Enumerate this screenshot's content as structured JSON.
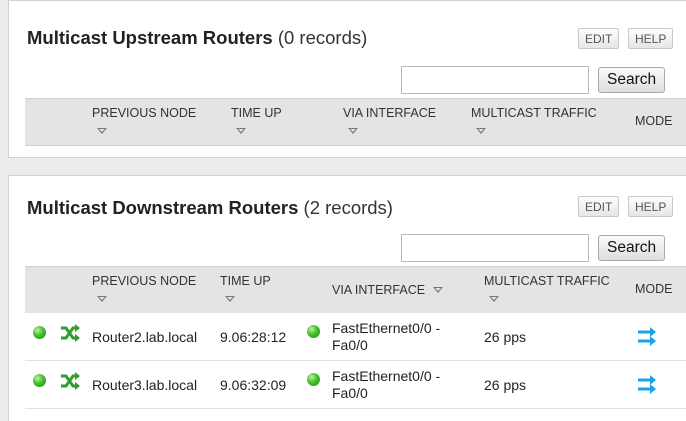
{
  "upstream": {
    "title": "Multicast Upstream Routers",
    "count": "(0 records)",
    "edit_label": "EDIT",
    "help_label": "HELP",
    "search_placeholder": "",
    "search_label": "Search",
    "columns": {
      "previous_node": "PREVIOUS NODE",
      "time_up": "TIME UP",
      "via_interface": "VIA INTERFACE",
      "multicast_traffic": "MULTICAST TRAFFIC",
      "mode": "MODE"
    }
  },
  "downstream": {
    "title": "Multicast Downstream Routers",
    "count": "(2 records)",
    "edit_label": "EDIT",
    "help_label": "HELP",
    "search_placeholder": "",
    "search_label": "Search",
    "columns": {
      "previous_node": "PREVIOUS NODE",
      "time_up": "TIME UP",
      "via_interface": "VIA INTERFACE",
      "multicast_traffic": "MULTICAST TRAFFIC",
      "mode": "MODE"
    },
    "rows": [
      {
        "status_icon": "green-status-dot",
        "node_icon": "router-shuffle-icon",
        "node": "Router2.lab.local",
        "time_up": "9.06:28:12",
        "interface_status_icon": "green-status-dot",
        "interface_line1": "FastEthernet0/0 -",
        "interface_line2": "Fa0/0",
        "traffic": "26 pps",
        "mode_icon": "bidirectional-arrows-icon"
      },
      {
        "status_icon": "green-status-dot",
        "node_icon": "router-shuffle-icon",
        "node": "Router3.lab.local",
        "time_up": "9.06:32:09",
        "interface_status_icon": "green-status-dot",
        "interface_line1": "FastEthernet0/0 -",
        "interface_line2": "Fa0/0",
        "traffic": "26 pps",
        "mode_icon": "bidirectional-arrows-icon"
      }
    ]
  },
  "colors": {
    "status_green": "#3fbf2a",
    "router_icon_green": "#2e9e2e",
    "mode_icon_blue": "#1aa3e8",
    "header_bg": "#e4e4e4"
  }
}
